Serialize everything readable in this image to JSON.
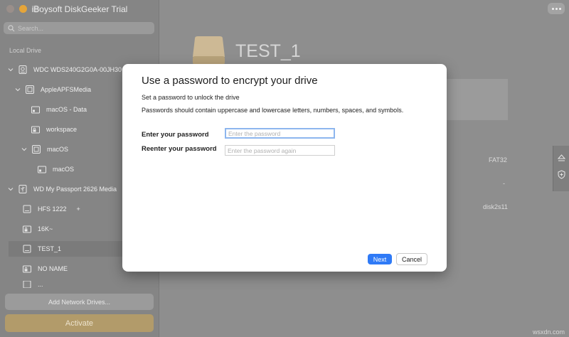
{
  "window": {
    "title": "iBoysoft DiskGeeker Trial"
  },
  "sidebar": {
    "search_placeholder": "Search...",
    "section_label": "Local Drive",
    "items": [
      {
        "label": "WDC WDS240G2G0A-00JH30"
      },
      {
        "label": "AppleAPFSMedia"
      },
      {
        "label": "macOS - Data"
      },
      {
        "label": "workspace"
      },
      {
        "label": "macOS"
      },
      {
        "label": "macOS"
      },
      {
        "label": "WD My Passport 2626 Media"
      },
      {
        "label": "HFS 1222",
        "extra": "+"
      },
      {
        "label": "16K~"
      },
      {
        "label": "TEST_1"
      },
      {
        "label": "NO NAME"
      },
      {
        "label": "..."
      }
    ],
    "add_network_label": "Add Network Drives...",
    "activate_label": "Activate"
  },
  "main": {
    "drive_title": "TEST_1",
    "fs_value": "FAT32",
    "dash_value": "-",
    "device_value": "disk2s11"
  },
  "modal": {
    "title": "Use a password to encrypt your drive",
    "desc1": "Set a password to unlock the drive",
    "desc2": "Passwords should contain uppercase and lowercase letters, numbers, spaces, and symbols.",
    "password_label": "Enter your password",
    "password_placeholder": "Enter the password",
    "password_value": "",
    "reenter_label": "Reenter your password",
    "reenter_placeholder": "Enter the password again",
    "reenter_value": "",
    "next_label": "Next",
    "cancel_label": "Cancel"
  },
  "watermark": "wsxdn.com",
  "colors": {
    "accent": "#2f7af6",
    "activate": "#b29b6a",
    "focus_ring": "#8db6ee"
  }
}
